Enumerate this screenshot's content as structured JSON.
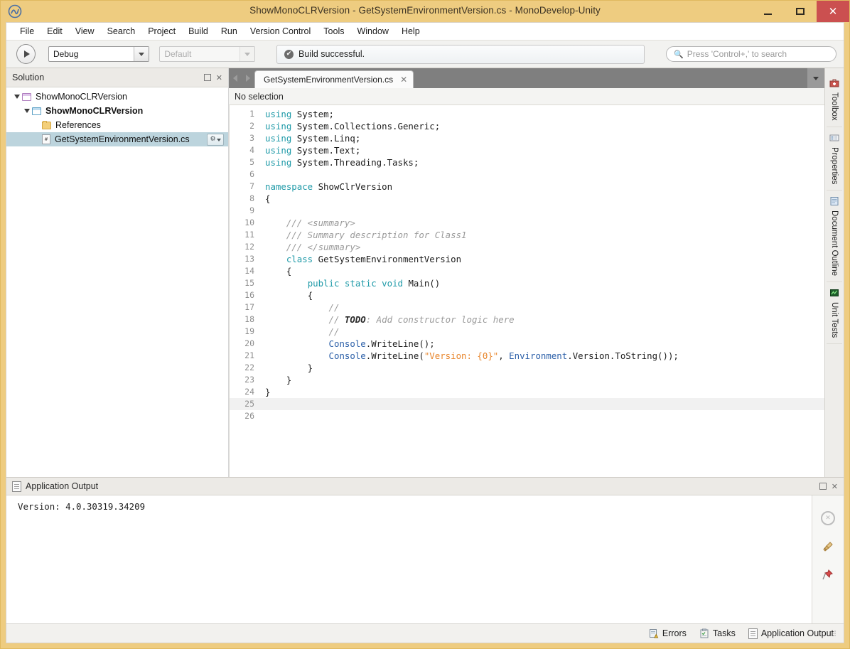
{
  "window": {
    "title": "ShowMonoCLRVersion - GetSystemEnvironmentVersion.cs - MonoDevelop-Unity",
    "app_icon": "monodevelop-icon",
    "minimize_label": "minimize",
    "maximize_label": "maximize",
    "close_label": "✕"
  },
  "menubar": {
    "items": [
      {
        "label": "File"
      },
      {
        "label": "Edit"
      },
      {
        "label": "View"
      },
      {
        "label": "Search"
      },
      {
        "label": "Project"
      },
      {
        "label": "Build"
      },
      {
        "label": "Run"
      },
      {
        "label": "Version Control"
      },
      {
        "label": "Tools"
      },
      {
        "label": "Window"
      },
      {
        "label": "Help"
      }
    ]
  },
  "toolbar": {
    "run_button": "run-icon",
    "configuration": {
      "value": "Debug"
    },
    "runtime": {
      "value": "Default",
      "disabled": true
    },
    "status": {
      "icon": "✔",
      "text": "Build successful."
    },
    "search": {
      "icon": "search-icon",
      "placeholder": "Press 'Control+,' to search",
      "value": ""
    }
  },
  "solution_pad": {
    "title": "Solution",
    "minimize_label": "□",
    "close_label": "✕",
    "tree": [
      {
        "label": "ShowMonoCLRVersion",
        "icon": "solution-icon",
        "indent": 0,
        "expanded": true,
        "bold": false,
        "selected": false
      },
      {
        "label": "ShowMonoCLRVersion",
        "icon": "project-icon",
        "indent": 1,
        "expanded": true,
        "bold": true,
        "selected": false
      },
      {
        "label": "References",
        "icon": "folder-icon",
        "indent": 2,
        "expanded": false,
        "bold": false,
        "selected": false
      },
      {
        "label": "GetSystemEnvironmentVersion.cs",
        "icon": "csharp-file-icon",
        "indent": 2,
        "expanded": false,
        "bold": false,
        "selected": true,
        "gear": "⚙"
      }
    ]
  },
  "editor": {
    "nav_back": "chevron-left-icon",
    "nav_forward": "chevron-right-icon",
    "tab": {
      "label": "GetSystemEnvironmentVersion.cs",
      "close": "✕"
    },
    "tab_dropdown": "chevron-down-icon",
    "breadcrumb": "No selection",
    "lines": [
      {
        "n": 1,
        "tokens": [
          {
            "t": "using",
            "c": "kw"
          },
          {
            "t": " System;",
            "c": ""
          }
        ]
      },
      {
        "n": 2,
        "tokens": [
          {
            "t": "using",
            "c": "kw"
          },
          {
            "t": " System.Collections.Generic;",
            "c": ""
          }
        ]
      },
      {
        "n": 3,
        "tokens": [
          {
            "t": "using",
            "c": "kw"
          },
          {
            "t": " System.Linq;",
            "c": ""
          }
        ]
      },
      {
        "n": 4,
        "tokens": [
          {
            "t": "using",
            "c": "kw"
          },
          {
            "t": " System.Text;",
            "c": ""
          }
        ]
      },
      {
        "n": 5,
        "tokens": [
          {
            "t": "using",
            "c": "kw"
          },
          {
            "t": " System.Threading.Tasks;",
            "c": ""
          }
        ]
      },
      {
        "n": 6,
        "tokens": []
      },
      {
        "n": 7,
        "tokens": [
          {
            "t": "namespace",
            "c": "kw"
          },
          {
            "t": " ShowClrVersion",
            "c": ""
          }
        ]
      },
      {
        "n": 8,
        "tokens": [
          {
            "t": "{",
            "c": ""
          }
        ]
      },
      {
        "n": 9,
        "tokens": []
      },
      {
        "n": 10,
        "tokens": [
          {
            "t": "    /// <summary>",
            "c": "cm"
          }
        ]
      },
      {
        "n": 11,
        "tokens": [
          {
            "t": "    /// Summary description for Class1",
            "c": "cm"
          }
        ]
      },
      {
        "n": 12,
        "tokens": [
          {
            "t": "    /// </summary>",
            "c": "cm"
          }
        ]
      },
      {
        "n": 13,
        "tokens": [
          {
            "t": "    ",
            "c": ""
          },
          {
            "t": "class",
            "c": "kw"
          },
          {
            "t": " GetSystemEnvironmentVersion",
            "c": ""
          }
        ]
      },
      {
        "n": 14,
        "tokens": [
          {
            "t": "    {",
            "c": ""
          }
        ]
      },
      {
        "n": 15,
        "tokens": [
          {
            "t": "        ",
            "c": ""
          },
          {
            "t": "public",
            "c": "kw"
          },
          {
            "t": " ",
            "c": ""
          },
          {
            "t": "static",
            "c": "kw"
          },
          {
            "t": " ",
            "c": ""
          },
          {
            "t": "void",
            "c": "kw"
          },
          {
            "t": " Main()",
            "c": ""
          }
        ]
      },
      {
        "n": 16,
        "tokens": [
          {
            "t": "        {",
            "c": ""
          }
        ]
      },
      {
        "n": 17,
        "tokens": [
          {
            "t": "            //",
            "c": "cm"
          }
        ]
      },
      {
        "n": 18,
        "tokens": [
          {
            "t": "            // ",
            "c": "cm"
          },
          {
            "t": "TODO",
            "c": "cmb"
          },
          {
            "t": ": Add constructor logic here",
            "c": "cm"
          }
        ]
      },
      {
        "n": 19,
        "tokens": [
          {
            "t": "            //",
            "c": "cm"
          }
        ]
      },
      {
        "n": 20,
        "tokens": [
          {
            "t": "            ",
            "c": ""
          },
          {
            "t": "Console",
            "c": "ty"
          },
          {
            "t": ".WriteLine();",
            "c": ""
          }
        ]
      },
      {
        "n": 21,
        "tokens": [
          {
            "t": "            ",
            "c": ""
          },
          {
            "t": "Console",
            "c": "ty"
          },
          {
            "t": ".WriteLine(",
            "c": ""
          },
          {
            "t": "\"Version: {0}\"",
            "c": "st"
          },
          {
            "t": ", ",
            "c": ""
          },
          {
            "t": "Environment",
            "c": "ty"
          },
          {
            "t": ".Version.ToString());",
            "c": ""
          }
        ]
      },
      {
        "n": 22,
        "tokens": [
          {
            "t": "        }",
            "c": ""
          }
        ]
      },
      {
        "n": 23,
        "tokens": [
          {
            "t": "    }",
            "c": ""
          }
        ]
      },
      {
        "n": 24,
        "tokens": [
          {
            "t": "}",
            "c": ""
          }
        ]
      },
      {
        "n": 25,
        "tokens": [],
        "highlight": true
      },
      {
        "n": 26,
        "tokens": []
      }
    ]
  },
  "right_rail": {
    "tabs": [
      {
        "label": "Toolbox",
        "icon": "toolbox-icon"
      },
      {
        "label": "Properties",
        "icon": "properties-icon"
      },
      {
        "label": "Document Outline",
        "icon": "document-outline-icon"
      },
      {
        "label": "Unit Tests",
        "icon": "unit-tests-icon"
      }
    ]
  },
  "output_pad": {
    "title": "Application Output",
    "icon": "document-icon",
    "minimize_label": "□",
    "close_label": "✕",
    "text": "Version: 4.0.30319.34209",
    "side_buttons": [
      {
        "name": "stop-button",
        "icon": "✕"
      },
      {
        "name": "clear-button",
        "icon": "broom-icon"
      },
      {
        "name": "pin-button",
        "icon": "pin-icon"
      }
    ]
  },
  "statusbar": {
    "items": [
      {
        "label": "Errors",
        "icon": "errors-icon"
      },
      {
        "label": "Tasks",
        "icon": "tasks-icon"
      },
      {
        "label": "Application Output",
        "icon": "document-icon"
      }
    ]
  },
  "colors": {
    "window_chrome": "#eecc80",
    "close_button": "#cb5050",
    "keyword": "#1f9aa8",
    "type": "#2b5fa8",
    "string": "#e8852b",
    "comment": "#9a9a9a",
    "selection": "#bcd4dd"
  }
}
